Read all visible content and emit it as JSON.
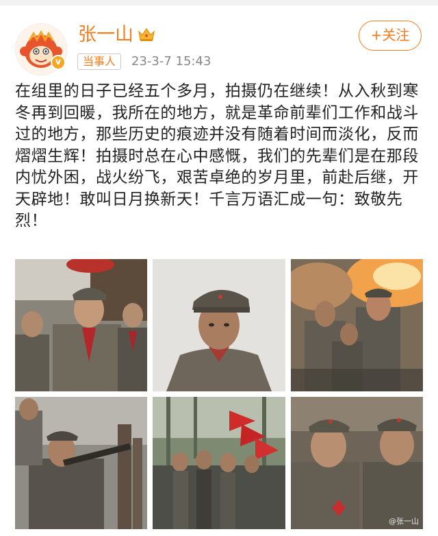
{
  "user": {
    "name": "张一山",
    "badge": "当事人",
    "timestamp": "23-3-7 15:43",
    "verified_mark": "v",
    "verified_color": "#f5a623",
    "name_color": "#f57d1f"
  },
  "follow_button": {
    "label": "+关注"
  },
  "post": {
    "text": "在组里的日子已经五个多月，拍摄仍在继续！从入秋到寒冬再到回暖，我所在的地方，就是革命前辈们工作和战斗过的地方，那些历史的痕迹并没有随着时间而淡化，反而熠熠生辉！拍摄时总在心中感慨，我们的先辈们是在那段内忧外困，战火纷飞，艰苦卓绝的岁月里，前赴后继，开天辟地！敢叫日月换新天！千言万语汇成一句：致敬先烈！"
  },
  "photos": [
    {
      "scene": "soldiers-marching-red-scarves"
    },
    {
      "scene": "soldier-portrait-closeup"
    },
    {
      "scene": "battle-explosion-soldiers"
    },
    {
      "scene": "soldier-aiming-rifle"
    },
    {
      "scene": "troops-with-red-flags"
    },
    {
      "scene": "two-soldiers-closeup",
      "watermark": "@张一山"
    }
  ],
  "icons": {
    "crown": "crown-icon",
    "avatar": "monkey-avatar-icon"
  }
}
